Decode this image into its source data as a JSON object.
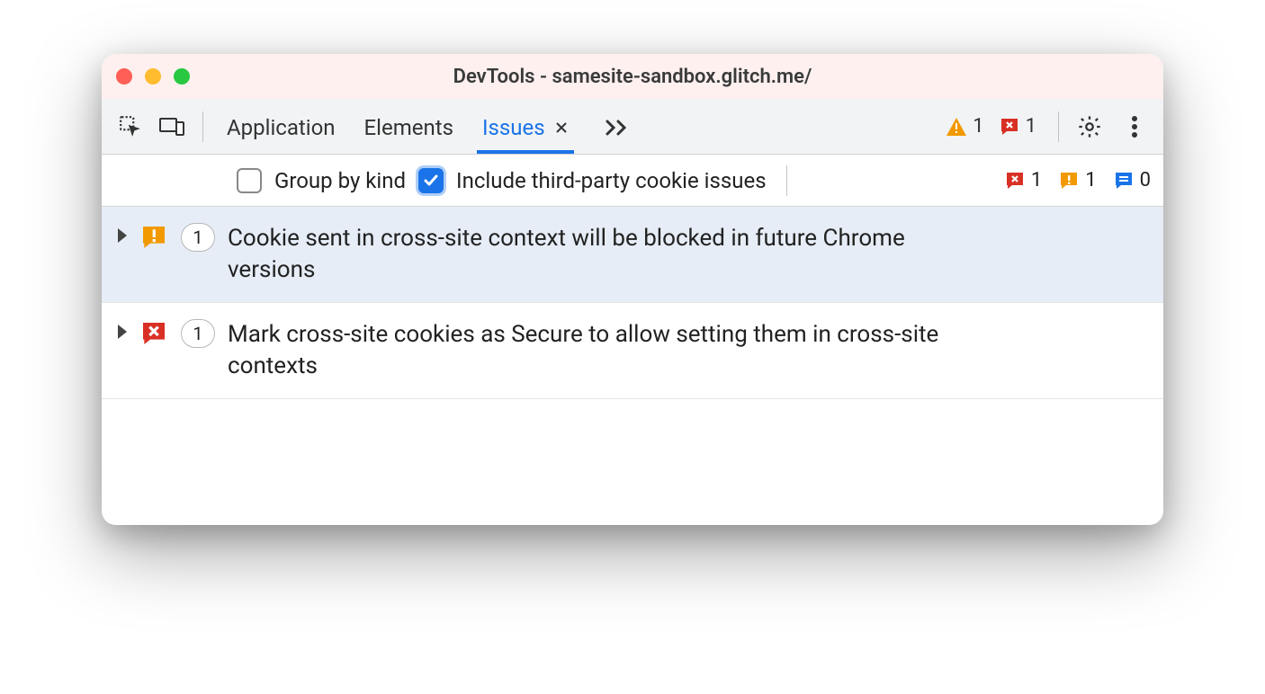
{
  "window": {
    "title": "DevTools - samesite-sandbox.glitch.me/"
  },
  "tabs": {
    "items": [
      {
        "label": "Application",
        "active": false
      },
      {
        "label": "Elements",
        "active": false
      },
      {
        "label": "Issues",
        "active": true,
        "closeable": true
      }
    ]
  },
  "header_counts": {
    "warning": "1",
    "error": "1"
  },
  "filterbar": {
    "group_by_kind_label": "Group by kind",
    "group_by_kind_checked": false,
    "include_third_party_label": "Include third-party cookie issues",
    "include_third_party_checked": true,
    "counts": {
      "error": "1",
      "warning": "1",
      "info": "0"
    }
  },
  "issues": [
    {
      "severity": "warning",
      "count": "1",
      "title": "Cookie sent in cross-site context will be blocked in future Chrome versions",
      "selected": true
    },
    {
      "severity": "error",
      "count": "1",
      "title": "Mark cross-site cookies as Secure to allow setting them in cross-site contexts",
      "selected": false
    }
  ],
  "colors": {
    "warning": "#f29900",
    "error": "#d93025",
    "info": "#1a73e8"
  }
}
